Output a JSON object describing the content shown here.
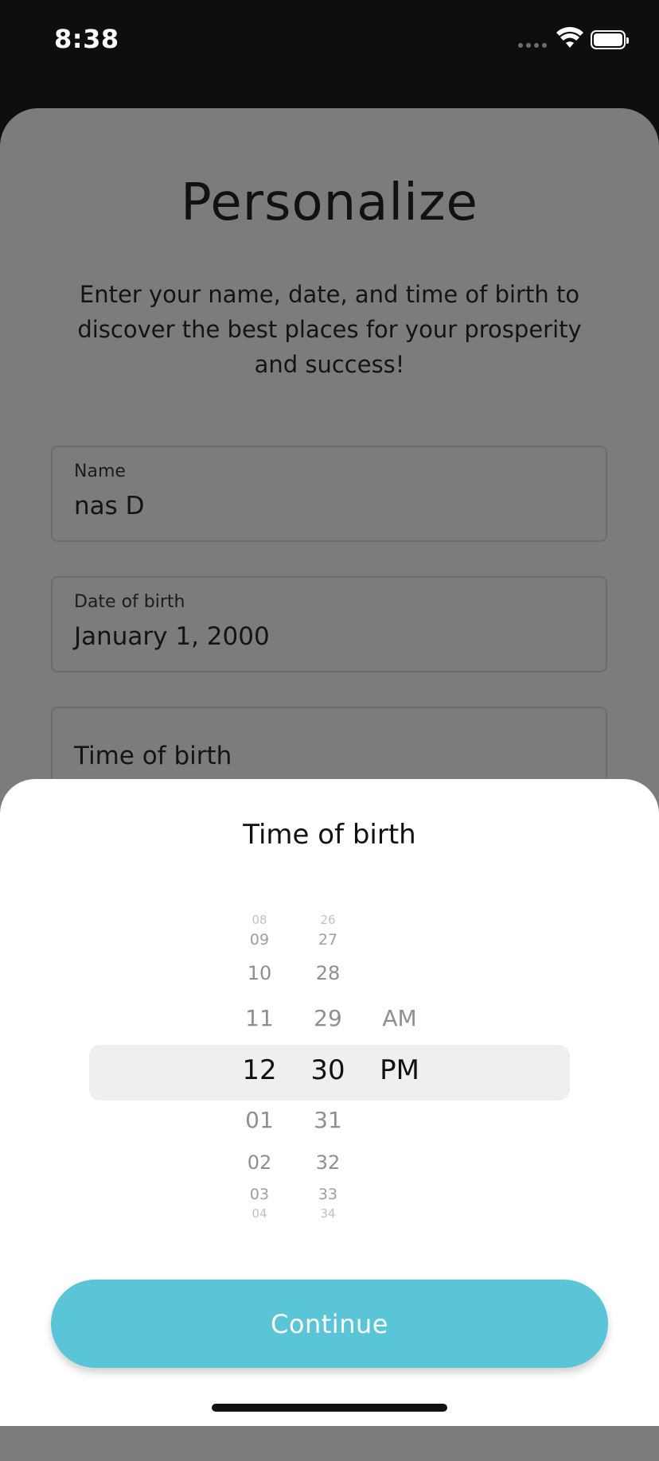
{
  "status_bar": {
    "time": "8:38"
  },
  "page": {
    "title": "Personalize",
    "subtitle": "Enter your name, date, and time of birth to discover the best places for your prosperity and success!"
  },
  "form": {
    "name_label": "Name",
    "name_value": "nas D",
    "dob_label": "Date of birth",
    "dob_value": "January 1, 2000",
    "tob_label": "Time of birth"
  },
  "sheet": {
    "title": "Time of birth",
    "hours": [
      "08",
      "09",
      "10",
      "11",
      "12",
      "01",
      "02",
      "03",
      "04"
    ],
    "minutes": [
      "26",
      "27",
      "28",
      "29",
      "30",
      "31",
      "32",
      "33",
      "34"
    ],
    "periods": [
      "AM",
      "PM"
    ],
    "selected": {
      "hour": "12",
      "minute": "30",
      "period": "PM"
    },
    "continue_label": "Continue"
  },
  "colors": {
    "accent": "#5bc5d8",
    "overlay_card": "#7c7c7c",
    "status_bar_bg": "#0e0e10"
  }
}
